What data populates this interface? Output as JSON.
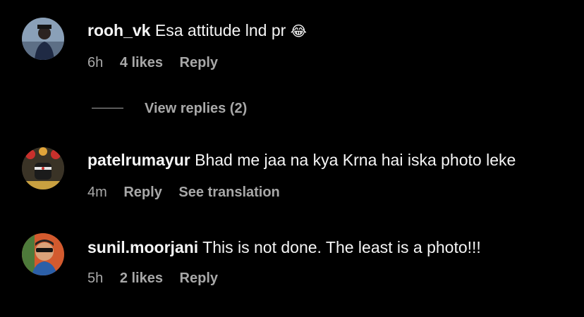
{
  "comments": [
    {
      "username": "rooh_vk",
      "text": "Esa attitude lnd pr",
      "emoji": "😂",
      "time": "6h",
      "likes": "4 likes",
      "reply": "Reply"
    },
    {
      "username": "patelrumayur",
      "text": "Bhad me jaa na kya Krna hai iska photo leke",
      "time": "4m",
      "reply": "Reply",
      "translation": "See translation"
    },
    {
      "username": "sunil.moorjani",
      "text": "This is not done. The least is a photo!!!",
      "time": "5h",
      "likes": "2 likes",
      "reply": "Reply"
    }
  ],
  "view_replies": "View replies (2)",
  "colors": {
    "background": "#000000",
    "primary_text": "#f5f5f5",
    "secondary_text": "#a8a8a8"
  },
  "icons": [
    "avatar-rooh-vk",
    "avatar-patelrumayur",
    "avatar-sunil-moorjani"
  ]
}
